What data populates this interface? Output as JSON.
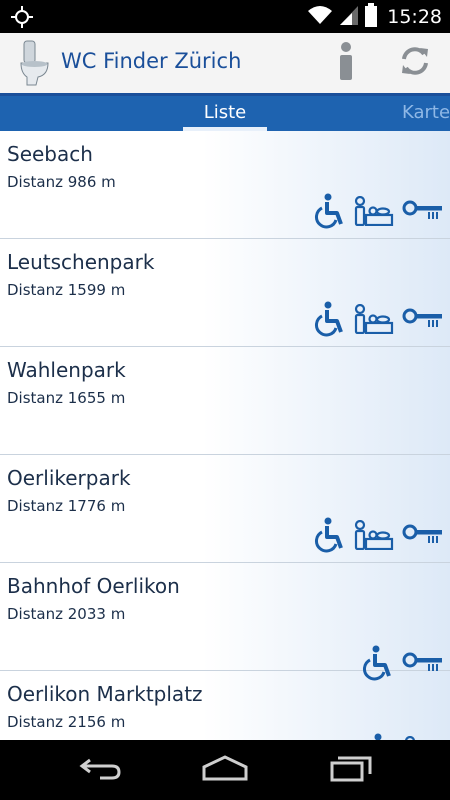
{
  "status_bar": {
    "time": "15:28",
    "icons": [
      "gps-icon",
      "wifi-icon",
      "signal-icon",
      "battery-icon"
    ]
  },
  "header": {
    "title": "WC Finder Zürich",
    "icons": [
      "toilet-logo-icon",
      "info-icon",
      "refresh-icon"
    ]
  },
  "tabs": [
    {
      "label": "Liste",
      "selected": true
    },
    {
      "label": "Karte",
      "selected": false
    }
  ],
  "list": {
    "items": [
      {
        "name": "Seebach",
        "distance": "Distanz 986 m",
        "icons": [
          "wheelchair-icon",
          "baby-changing-icon",
          "key-icon"
        ]
      },
      {
        "name": "Leutschenpark",
        "distance": "Distanz 1599 m",
        "icons": [
          "wheelchair-icon",
          "baby-changing-icon",
          "key-icon"
        ]
      },
      {
        "name": "Wahlenpark",
        "distance": "Distanz 1655 m",
        "icons": []
      },
      {
        "name": "Oerlikerpark",
        "distance": "Distanz 1776 m",
        "icons": [
          "wheelchair-icon",
          "baby-changing-icon",
          "key-icon"
        ]
      },
      {
        "name": "Bahnhof Oerlikon",
        "distance": "Distanz 2033 m",
        "icons": [
          "wheelchair-icon",
          "key-icon"
        ]
      },
      {
        "name": "Oerlikon Marktplatz",
        "distance": "Distanz 2156 m",
        "icons": [
          "wheelchair-icon",
          "baby-changing-icon"
        ]
      }
    ]
  },
  "nav_bar": {
    "icons": [
      "back-icon",
      "home-icon",
      "recent-apps-icon"
    ]
  },
  "colors": {
    "accent": "#1e63b0",
    "title": "#1a4f9a",
    "text": "#1c2f4a",
    "icon": "#1a5ea8"
  }
}
